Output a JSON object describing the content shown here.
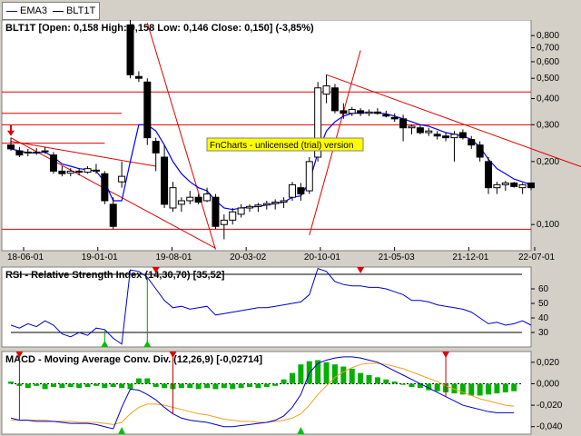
{
  "legend": [
    {
      "name": "EMA3",
      "color": "#0000ff"
    },
    {
      "name": "BLT1T",
      "color": "#000000"
    }
  ],
  "watermark": "FnCharts - unlicensed (trial) version",
  "chart_data": [
    {
      "type": "candlestick",
      "title": "BLT1T [Open: 0,158  High: 0,158  Low: 0,146  Close: 0,150] (-3,85%)",
      "scale": "log",
      "ylim": [
        0.075,
        0.95
      ],
      "y_ticks": [
        0.1,
        0.2,
        0.3,
        0.4,
        0.5,
        0.6,
        0.7,
        0.8
      ],
      "y_tick_labels": [
        "0,100",
        "0,200",
        "0,300",
        "0,400",
        "0,500",
        "0,600",
        "0,700",
        "0,800"
      ],
      "x_tick_labels": [
        "18-06-01",
        "19-01-01",
        "19-08-01",
        "20-03-02",
        "20-10-01",
        "21-05-03",
        "21-12-01",
        "22-07-01"
      ],
      "candles": [
        {
          "o": 0.24,
          "h": 0.26,
          "l": 0.225,
          "c": 0.23
        },
        {
          "o": 0.225,
          "h": 0.235,
          "l": 0.21,
          "c": 0.215
        },
        {
          "o": 0.22,
          "h": 0.23,
          "l": 0.212,
          "c": 0.222
        },
        {
          "o": 0.222,
          "h": 0.232,
          "l": 0.215,
          "c": 0.22
        },
        {
          "o": 0.225,
          "h": 0.235,
          "l": 0.218,
          "c": 0.223
        },
        {
          "o": 0.215,
          "h": 0.222,
          "l": 0.175,
          "c": 0.18
        },
        {
          "o": 0.18,
          "h": 0.19,
          "l": 0.17,
          "c": 0.175
        },
        {
          "o": 0.176,
          "h": 0.186,
          "l": 0.17,
          "c": 0.18
        },
        {
          "o": 0.18,
          "h": 0.186,
          "l": 0.172,
          "c": 0.178
        },
        {
          "o": 0.178,
          "h": 0.19,
          "l": 0.175,
          "c": 0.185
        },
        {
          "o": 0.182,
          "h": 0.195,
          "l": 0.175,
          "c": 0.18
        },
        {
          "o": 0.175,
          "h": 0.18,
          "l": 0.125,
          "c": 0.13
        },
        {
          "o": 0.125,
          "h": 0.135,
          "l": 0.095,
          "c": 0.098
        },
        {
          "o": 0.16,
          "h": 0.2,
          "l": 0.15,
          "c": 0.17
        },
        {
          "o": 0.9,
          "h": 0.95,
          "l": 0.5,
          "c": 0.52
        },
        {
          "o": 0.51,
          "h": 0.54,
          "l": 0.48,
          "c": 0.5
        },
        {
          "o": 0.48,
          "h": 0.5,
          "l": 0.24,
          "c": 0.26
        },
        {
          "o": 0.25,
          "h": 0.26,
          "l": 0.18,
          "c": 0.22
        },
        {
          "o": 0.21,
          "h": 0.24,
          "l": 0.12,
          "c": 0.125
        },
        {
          "o": 0.12,
          "h": 0.16,
          "l": 0.115,
          "c": 0.15
        },
        {
          "o": 0.125,
          "h": 0.135,
          "l": 0.115,
          "c": 0.13
        },
        {
          "o": 0.13,
          "h": 0.145,
          "l": 0.125,
          "c": 0.135
        },
        {
          "o": 0.135,
          "h": 0.14,
          "l": 0.125,
          "c": 0.128
        },
        {
          "o": 0.13,
          "h": 0.15,
          "l": 0.128,
          "c": 0.14
        },
        {
          "o": 0.135,
          "h": 0.14,
          "l": 0.095,
          "c": 0.098
        },
        {
          "o": 0.1,
          "h": 0.112,
          "l": 0.085,
          "c": 0.105
        },
        {
          "o": 0.105,
          "h": 0.12,
          "l": 0.1,
          "c": 0.115
        },
        {
          "o": 0.112,
          "h": 0.125,
          "l": 0.108,
          "c": 0.12
        },
        {
          "o": 0.12,
          "h": 0.125,
          "l": 0.115,
          "c": 0.122
        },
        {
          "o": 0.122,
          "h": 0.127,
          "l": 0.115,
          "c": 0.124
        },
        {
          "o": 0.124,
          "h": 0.13,
          "l": 0.118,
          "c": 0.126
        },
        {
          "o": 0.126,
          "h": 0.132,
          "l": 0.118,
          "c": 0.128
        },
        {
          "o": 0.128,
          "h": 0.135,
          "l": 0.12,
          "c": 0.13
        },
        {
          "o": 0.135,
          "h": 0.16,
          "l": 0.13,
          "c": 0.155
        },
        {
          "o": 0.15,
          "h": 0.158,
          "l": 0.13,
          "c": 0.14
        },
        {
          "o": 0.145,
          "h": 0.21,
          "l": 0.14,
          "c": 0.2
        },
        {
          "o": 0.21,
          "h": 0.48,
          "l": 0.2,
          "c": 0.45
        },
        {
          "o": 0.42,
          "h": 0.52,
          "l": 0.38,
          "c": 0.46
        },
        {
          "o": 0.45,
          "h": 0.47,
          "l": 0.34,
          "c": 0.35
        },
        {
          "o": 0.35,
          "h": 0.38,
          "l": 0.32,
          "c": 0.34
        },
        {
          "o": 0.34,
          "h": 0.365,
          "l": 0.33,
          "c": 0.355
        },
        {
          "o": 0.35,
          "h": 0.36,
          "l": 0.33,
          "c": 0.34
        },
        {
          "o": 0.34,
          "h": 0.355,
          "l": 0.33,
          "c": 0.345
        },
        {
          "o": 0.345,
          "h": 0.36,
          "l": 0.335,
          "c": 0.34
        },
        {
          "o": 0.335,
          "h": 0.35,
          "l": 0.325,
          "c": 0.33
        },
        {
          "o": 0.325,
          "h": 0.34,
          "l": 0.31,
          "c": 0.32
        },
        {
          "o": 0.32,
          "h": 0.335,
          "l": 0.25,
          "c": 0.29
        },
        {
          "o": 0.29,
          "h": 0.3,
          "l": 0.27,
          "c": 0.295
        },
        {
          "o": 0.29,
          "h": 0.3,
          "l": 0.27,
          "c": 0.275
        },
        {
          "o": 0.275,
          "h": 0.29,
          "l": 0.265,
          "c": 0.28
        },
        {
          "o": 0.27,
          "h": 0.28,
          "l": 0.255,
          "c": 0.265
        },
        {
          "o": 0.265,
          "h": 0.275,
          "l": 0.25,
          "c": 0.26
        },
        {
          "o": 0.26,
          "h": 0.28,
          "l": 0.2,
          "c": 0.27
        },
        {
          "o": 0.275,
          "h": 0.285,
          "l": 0.255,
          "c": 0.26
        },
        {
          "o": 0.255,
          "h": 0.265,
          "l": 0.23,
          "c": 0.24
        },
        {
          "o": 0.24,
          "h": 0.25,
          "l": 0.2,
          "c": 0.21
        },
        {
          "o": 0.2,
          "h": 0.21,
          "l": 0.14,
          "c": 0.15
        },
        {
          "o": 0.15,
          "h": 0.16,
          "l": 0.14,
          "c": 0.155
        },
        {
          "o": 0.155,
          "h": 0.162,
          "l": 0.145,
          "c": 0.158
        },
        {
          "o": 0.158,
          "h": 0.16,
          "l": 0.15,
          "c": 0.152
        },
        {
          "o": 0.15,
          "h": 0.158,
          "l": 0.14,
          "c": 0.155
        },
        {
          "o": 0.158,
          "h": 0.158,
          "l": 0.146,
          "c": 0.15
        }
      ],
      "ema3": [
        0.23,
        0.225,
        0.22,
        0.22,
        0.222,
        0.21,
        0.195,
        0.19,
        0.185,
        0.183,
        0.18,
        0.16,
        0.13,
        0.13,
        0.2,
        0.3,
        0.3,
        0.28,
        0.24,
        0.2,
        0.175,
        0.16,
        0.15,
        0.145,
        0.13,
        0.12,
        0.118,
        0.12,
        0.121,
        0.122,
        0.124,
        0.126,
        0.128,
        0.135,
        0.137,
        0.16,
        0.22,
        0.28,
        0.31,
        0.33,
        0.34,
        0.342,
        0.343,
        0.342,
        0.338,
        0.33,
        0.32,
        0.31,
        0.3,
        0.295,
        0.285,
        0.275,
        0.27,
        0.265,
        0.255,
        0.235,
        0.205,
        0.185,
        0.175,
        0.165,
        0.16,
        0.155
      ],
      "horizontal_lines": [
        0.43,
        0.3,
        0.095
      ],
      "short_lines": [
        {
          "y": 0.34,
          "x0": 0,
          "x1": 13
        },
        {
          "y": 0.245,
          "x0": 0,
          "x1": 11
        }
      ],
      "trendlines": [
        {
          "x0": 0,
          "y0": 0.26,
          "x1": 24,
          "y1": 0.077
        },
        {
          "x0": 0,
          "y0": 0.25,
          "x1": 17,
          "y1": 0.19
        },
        {
          "x0": 16,
          "y0": 0.92,
          "x1": 24,
          "y1": 0.076
        },
        {
          "x0": 35,
          "y0": 0.089,
          "x1": 41,
          "y1": 0.68
        },
        {
          "x0": 37,
          "y0": 0.52,
          "x1": 70,
          "y1": 0.17
        }
      ],
      "marker": {
        "type": "down-arrow",
        "index": 0,
        "y": 0.265
      }
    },
    {
      "type": "line",
      "title": "RSI - Relative Strength Index (14,30,70) [35,52]",
      "ylim": [
        20,
        75
      ],
      "y_ticks": [
        30,
        40,
        50,
        60
      ],
      "y_tick_labels": [
        "30",
        "40",
        "50",
        "60"
      ],
      "levels": [
        30,
        70
      ],
      "values": [
        35,
        33,
        36,
        34,
        38,
        35,
        29,
        27,
        30,
        28,
        33,
        32,
        26,
        22,
        73,
        72,
        68,
        60,
        52,
        47,
        48,
        46,
        47,
        48,
        42,
        43,
        44,
        45,
        46,
        47,
        47,
        48,
        49,
        50,
        51,
        56,
        74,
        72,
        65,
        63,
        62,
        62,
        61,
        61,
        60,
        58,
        56,
        52,
        52,
        51,
        49,
        48,
        47,
        46,
        44,
        40,
        36,
        37,
        35,
        36,
        38,
        35
      ],
      "signals": [
        {
          "type": "buy",
          "index": 11
        },
        {
          "type": "buy",
          "index": 16
        },
        {
          "type": "sell",
          "index": 17
        },
        {
          "type": "sell",
          "index": 41
        }
      ]
    },
    {
      "type": "macd",
      "title": "MACD - Moving Average Conv. Div. (12,26,9) [-0,02714]",
      "ylim": [
        -0.047,
        0.03
      ],
      "y_ticks": [
        0.02,
        0.0,
        -0.02,
        -0.04
      ],
      "y_tick_labels": [
        "0,020",
        "0,000",
        "-0,020",
        "-0,040"
      ],
      "macd": [
        -0.032,
        -0.034,
        -0.034,
        -0.035,
        -0.035,
        -0.035,
        -0.036,
        -0.037,
        -0.037,
        -0.037,
        -0.038,
        -0.04,
        -0.042,
        -0.022,
        -0.005,
        -0.006,
        -0.01,
        -0.015,
        -0.022,
        -0.028,
        -0.032,
        -0.034,
        -0.035,
        -0.036,
        -0.038,
        -0.04,
        -0.04,
        -0.039,
        -0.038,
        -0.037,
        -0.036,
        -0.034,
        -0.03,
        -0.022,
        -0.01,
        0.01,
        0.019,
        0.022,
        0.024,
        0.025,
        0.025,
        0.024,
        0.022,
        0.02,
        0.016,
        0.012,
        0.008,
        0.004,
        0.0,
        -0.004,
        -0.008,
        -0.012,
        -0.016,
        -0.02,
        -0.022,
        -0.024,
        -0.026,
        -0.027,
        -0.027,
        -0.027
      ],
      "signal": [
        -0.034,
        -0.034,
        -0.034,
        -0.034,
        -0.034,
        -0.035,
        -0.035,
        -0.035,
        -0.036,
        -0.036,
        -0.036,
        -0.037,
        -0.038,
        -0.036,
        -0.028,
        -0.022,
        -0.019,
        -0.019,
        -0.02,
        -0.022,
        -0.024,
        -0.026,
        -0.028,
        -0.029,
        -0.031,
        -0.033,
        -0.034,
        -0.035,
        -0.035,
        -0.036,
        -0.036,
        -0.035,
        -0.034,
        -0.032,
        -0.028,
        -0.02,
        -0.01,
        -0.002,
        0.006,
        0.011,
        0.015,
        0.018,
        0.019,
        0.019,
        0.018,
        0.016,
        0.014,
        0.011,
        0.008,
        0.005,
        0.002,
        -0.002,
        -0.005,
        -0.008,
        -0.011,
        -0.014,
        -0.016,
        -0.018,
        -0.02,
        -0.021
      ],
      "histogram": [
        0.002,
        -0.002,
        -0.004,
        -0.002,
        -0.005,
        -0.003,
        -0.004,
        -0.003,
        -0.004,
        -0.003,
        -0.002,
        -0.004,
        -0.003,
        -0.004,
        -0.005,
        0.005,
        0.005,
        -0.003,
        -0.004,
        -0.005,
        -0.004,
        -0.004,
        -0.005,
        -0.004,
        -0.005,
        -0.004,
        -0.005,
        -0.004,
        -0.003,
        -0.004,
        -0.003,
        -0.002,
        0.004,
        0.01,
        0.018,
        0.021,
        0.022,
        0.02,
        0.018,
        0.016,
        0.014,
        0.01,
        0.008,
        0.006,
        0.004,
        0.002,
        -0.001,
        -0.003,
        -0.004,
        -0.006,
        -0.007,
        -0.008,
        -0.009,
        -0.01,
        -0.011,
        -0.011,
        -0.01,
        -0.009,
        -0.008,
        -0.007
      ],
      "signals": [
        {
          "type": "sell",
          "index": 1
        },
        {
          "type": "buy",
          "index": 13
        },
        {
          "type": "sell",
          "index": 19
        },
        {
          "type": "buy",
          "index": 34
        },
        {
          "type": "sell",
          "index": 51
        }
      ]
    }
  ]
}
